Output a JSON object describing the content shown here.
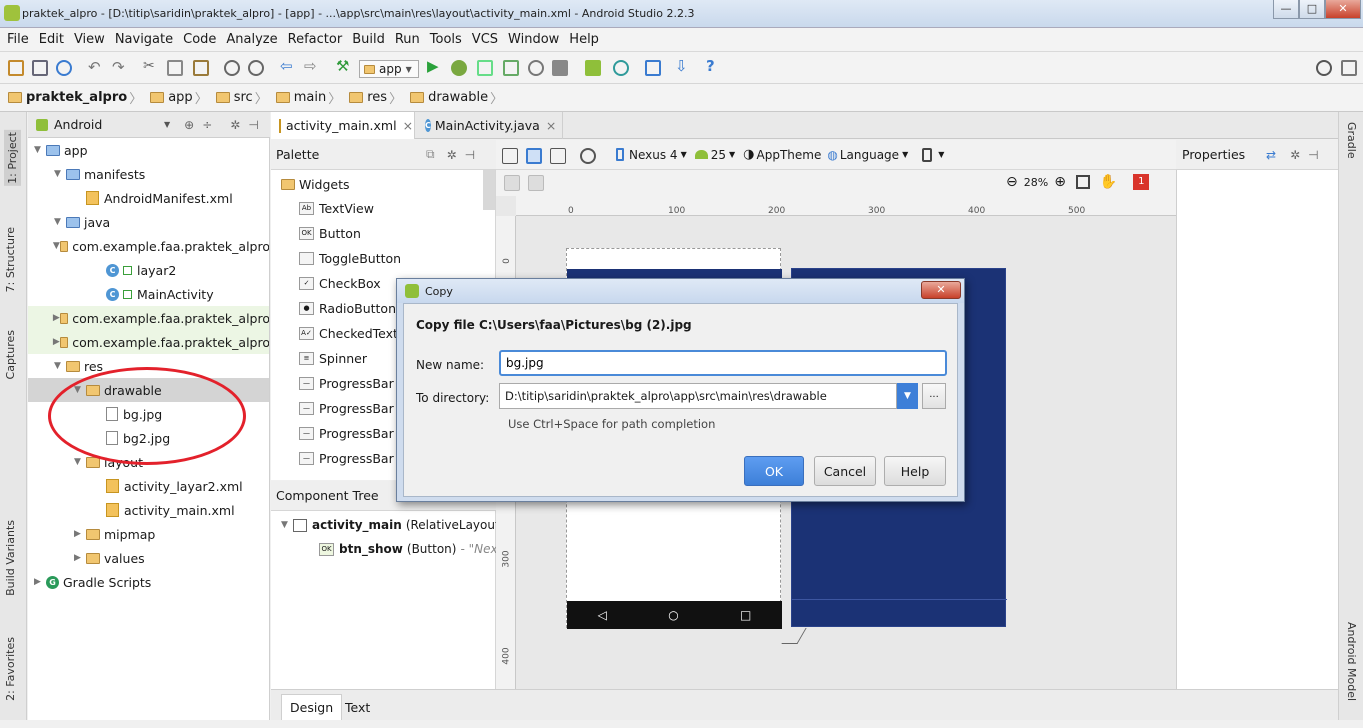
{
  "window": {
    "title": "praktek_alpro - [D:\\titip\\saridin\\praktek_alpro] - [app] - ...\\app\\src\\main\\res\\layout\\activity_main.xml - Android Studio 2.2.3",
    "minimize": "—",
    "maximize": "□",
    "close": "✕"
  },
  "menu": [
    "File",
    "Edit",
    "View",
    "Navigate",
    "Code",
    "Analyze",
    "Refactor",
    "Build",
    "Run",
    "Tools",
    "VCS",
    "Window",
    "Help"
  ],
  "toolbar": {
    "run_config": "app"
  },
  "breadcrumb": [
    "praktek_alpro",
    "app",
    "src",
    "main",
    "res",
    "drawable"
  ],
  "left_tabs": [
    "1: Project",
    "7: Structure",
    "Captures",
    "Build Variants",
    "2: Favorites"
  ],
  "right_tabs": [
    "Gradle",
    "Android Model"
  ],
  "project": {
    "view_mode": "Android",
    "tree": [
      {
        "label": "app",
        "depth": 0,
        "arrow": "▼",
        "icon": "folder-blue"
      },
      {
        "label": "manifests",
        "depth": 1,
        "arrow": "▼",
        "icon": "folder-blue"
      },
      {
        "label": "AndroidManifest.xml",
        "depth": 2,
        "arrow": "",
        "icon": "manifest"
      },
      {
        "label": "java",
        "depth": 1,
        "arrow": "▼",
        "icon": "folder-blue"
      },
      {
        "label": "com.example.faa.praktek_alpro",
        "depth": 2,
        "arrow": "▼",
        "icon": "package"
      },
      {
        "label": "layar2",
        "depth": 3,
        "arrow": "",
        "icon": "class"
      },
      {
        "label": "MainActivity",
        "depth": 3,
        "arrow": "",
        "icon": "class"
      },
      {
        "label": "com.example.faa.praktek_alpro",
        "depth": 2,
        "arrow": "▶",
        "icon": "package",
        "state": "mod"
      },
      {
        "label": "com.example.faa.praktek_alpro",
        "depth": 2,
        "arrow": "▶",
        "icon": "package",
        "state": "mod"
      },
      {
        "label": "res",
        "depth": 1,
        "arrow": "▼",
        "icon": "folder"
      },
      {
        "label": "drawable",
        "depth": 2,
        "arrow": "▼",
        "icon": "folder",
        "state": "sel"
      },
      {
        "label": "bg.jpg",
        "depth": 3,
        "arrow": "",
        "icon": "file"
      },
      {
        "label": "bg2.jpg",
        "depth": 3,
        "arrow": "",
        "icon": "file"
      },
      {
        "label": "layout",
        "depth": 2,
        "arrow": "▼",
        "icon": "folder"
      },
      {
        "label": "activity_layar2.xml",
        "depth": 3,
        "arrow": "",
        "icon": "xml"
      },
      {
        "label": "activity_main.xml",
        "depth": 3,
        "arrow": "",
        "icon": "xml"
      },
      {
        "label": "mipmap",
        "depth": 2,
        "arrow": "▶",
        "icon": "folder"
      },
      {
        "label": "values",
        "depth": 2,
        "arrow": "▶",
        "icon": "folder"
      },
      {
        "label": "Gradle Scripts",
        "depth": 0,
        "arrow": "▶",
        "icon": "gradle"
      }
    ]
  },
  "editor_tabs": [
    {
      "label": "activity_main.xml",
      "active": true,
      "close": "×"
    },
    {
      "label": "MainActivity.java",
      "active": false,
      "close": "×"
    }
  ],
  "palette": {
    "title": "Palette",
    "group": "Widgets",
    "items": [
      {
        "label": "TextView",
        "icon": "Ab"
      },
      {
        "label": "Button",
        "icon": "OK"
      },
      {
        "label": "ToggleButton",
        "icon": ""
      },
      {
        "label": "CheckBox",
        "icon": "✓"
      },
      {
        "label": "RadioButton",
        "icon": "●"
      },
      {
        "label": "CheckedTextView",
        "icon": "A✓"
      },
      {
        "label": "Spinner",
        "icon": "≡"
      },
      {
        "label": "ProgressBar",
        "icon": "—"
      },
      {
        "label": "ProgressBar",
        "icon": "—"
      },
      {
        "label": "ProgressBar",
        "icon": "—"
      },
      {
        "label": "ProgressBar",
        "icon": "—"
      }
    ]
  },
  "component_tree": {
    "title": "Component Tree",
    "root": {
      "name": "activity_main",
      "type": "(RelativeLayout)"
    },
    "child": {
      "name": "btn_show",
      "type": "(Button)",
      "text": "- \"Next\""
    }
  },
  "layout_toolbar": {
    "device": "Nexus 4",
    "api": "25",
    "theme": "AppTheme",
    "language": "Language",
    "zoom": "28%",
    "warnings": "1"
  },
  "ruler": {
    "x_ticks": [
      "0",
      "100",
      "200",
      "300",
      "400",
      "500"
    ],
    "y_ticks": [
      "0",
      "300",
      "400"
    ]
  },
  "properties": {
    "title": "Properties"
  },
  "design_tabs": [
    {
      "label": "Design",
      "active": true
    },
    {
      "label": "Text",
      "active": false
    }
  ],
  "dialog": {
    "title": "Copy",
    "heading": "Copy file C:\\Users\\faa\\Pictures\\bg (2).jpg",
    "new_name_label": "New name:",
    "new_name_value": "bg.jpg",
    "to_dir_label": "To directory:",
    "to_dir_value": "D:\\titip\\saridin\\praktek_alpro\\app\\src\\main\\res\\drawable",
    "browse": "...",
    "hint": "Use Ctrl+Space for path completion",
    "ok": "OK",
    "cancel": "Cancel",
    "help": "Help",
    "close": "✕"
  },
  "colors": {
    "accent": "#3d7fd8",
    "annotation": "#e3212b",
    "screen_blue": "#1b3275",
    "selection": "#d4d4d4"
  }
}
